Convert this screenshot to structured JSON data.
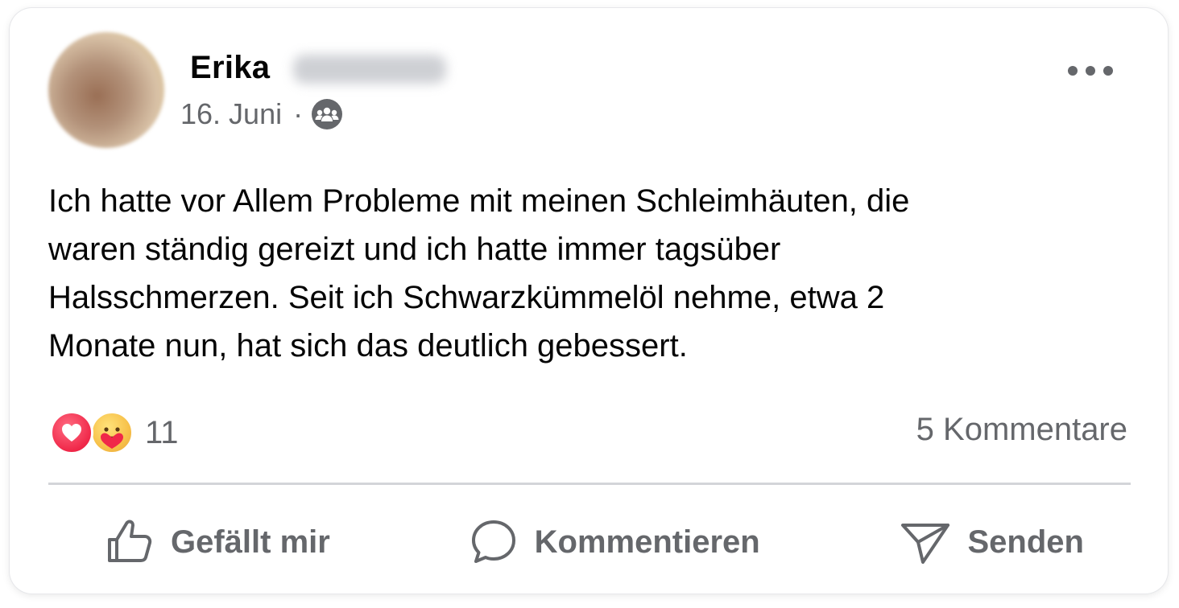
{
  "post": {
    "author": "Erika",
    "date": "16. Juni",
    "separator": "·",
    "privacy_icon": "group-audience-icon",
    "more_icon": "more-options-icon",
    "text": "Ich hatte vor Allem Probleme mit meinen Schleimhäuten, die\nwaren ständig gereizt und ich hatte immer tagsüber\nHalsschmerzen. Seit ich Schwarzkümmelöl nehme, etwa 2\nMonate nun, hat sich das deutlich gebessert."
  },
  "stats": {
    "reaction_icons": [
      "love-reaction-icon",
      "care-reaction-icon"
    ],
    "reaction_count": "11",
    "comments": "5 Kommentare"
  },
  "actions": {
    "like_label": "Gefällt mir",
    "comment_label": "Kommentieren",
    "send_label": "Senden"
  },
  "colors": {
    "text_primary": "#050505",
    "text_secondary": "#65676b",
    "love": "#f02849",
    "care": "#f7c14a",
    "divider": "#d3d5d9"
  }
}
